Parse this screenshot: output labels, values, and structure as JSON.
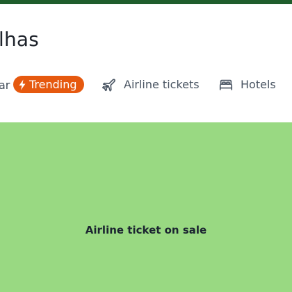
{
  "header": {
    "title": "lhas"
  },
  "nav": {
    "partial_item": "ar",
    "trending_label": "Trending",
    "trending_color": "#e6590f",
    "items": [
      {
        "label": "Airline tickets",
        "icon": "airplane-icon"
      },
      {
        "label": "Hotels",
        "icon": "bed-icon"
      }
    ]
  },
  "banner": {
    "text": "Airline ticket on sale",
    "background": "#99d982"
  },
  "colors": {
    "top_strip": "#1f5d2c",
    "accent": "#e6590f"
  }
}
